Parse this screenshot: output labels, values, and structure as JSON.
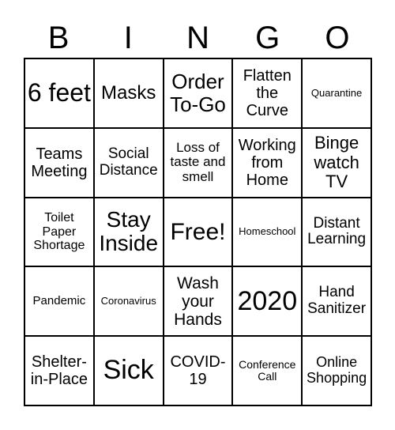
{
  "header": [
    "B",
    "I",
    "N",
    "G",
    "O"
  ],
  "cells": [
    "6 feet",
    "Masks",
    "Order To-Go",
    "Flatten the Curve",
    "Quarantine",
    "Teams Meeting",
    "Social Distance",
    "Loss of taste and smell",
    "Working from Home",
    "Binge watch TV",
    "Toilet Paper Shortage",
    "Stay Inside",
    "Free!",
    "Homeschool",
    "Distant Learning",
    "Pandemic",
    "Coronavirus",
    "Wash your Hands",
    "2020",
    "Hand Sanitizer",
    "Shelter-in-Place",
    "Sick",
    "COVID-19",
    "Conference Call",
    "Online Shopping"
  ]
}
